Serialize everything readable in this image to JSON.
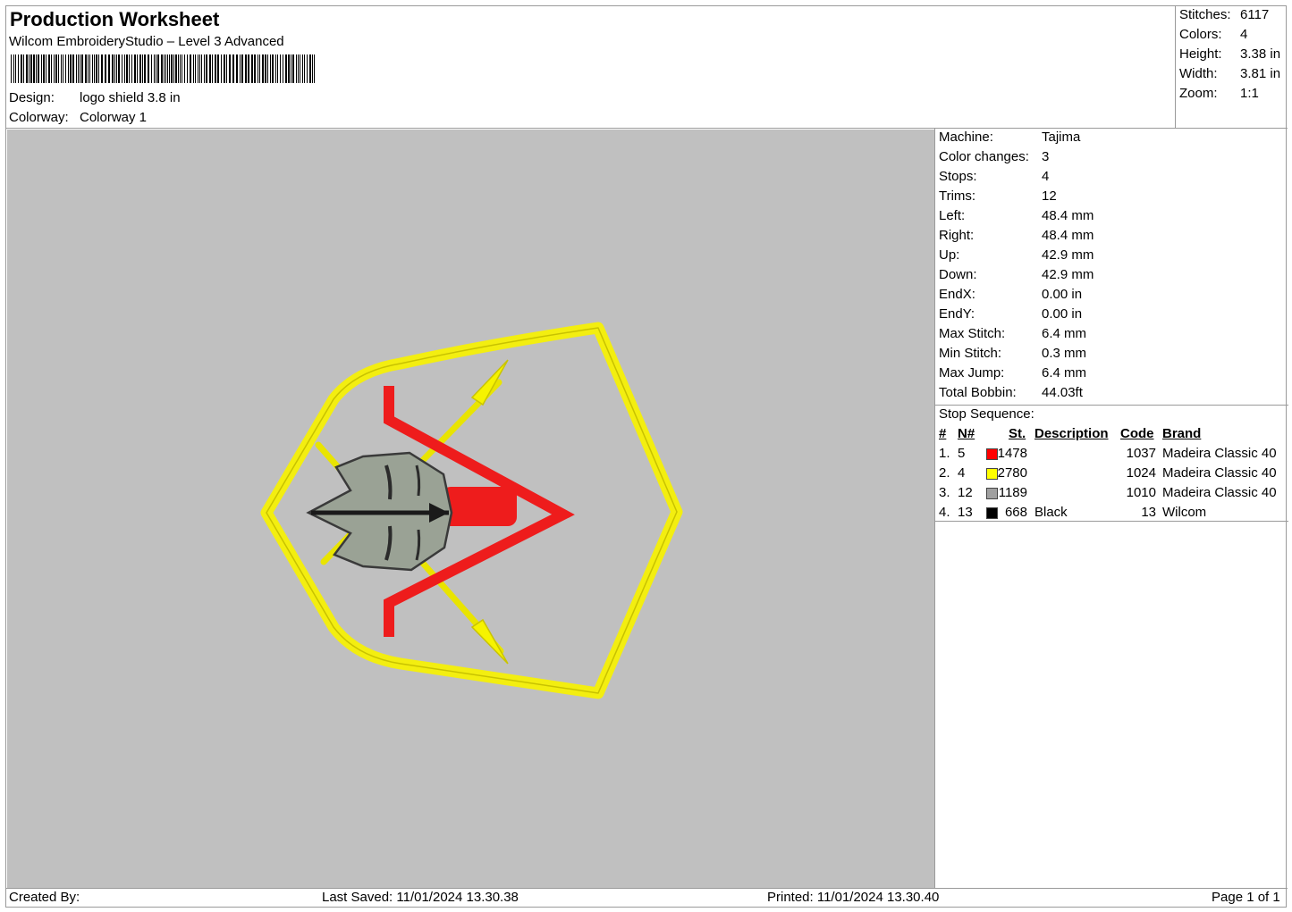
{
  "header": {
    "title": "Production Worksheet",
    "subtitle": "Wilcom EmbroideryStudio – Level 3 Advanced",
    "design_label": "Design:",
    "design_value": "logo shield 3.8 in",
    "colorway_label": "Colorway:",
    "colorway_value": "Colorway 1"
  },
  "stats": [
    {
      "label": "Stitches:",
      "value": "6117"
    },
    {
      "label": "Colors:",
      "value": "4"
    },
    {
      "label": "Height:",
      "value": "3.38 in"
    },
    {
      "label": "Width:",
      "value": "3.81 in"
    },
    {
      "label": "Zoom:",
      "value": "1:1"
    }
  ],
  "machine_info": [
    {
      "label": "Machine:",
      "value": "Tajima"
    },
    {
      "label": "Color changes:",
      "value": "3"
    },
    {
      "label": "Stops:",
      "value": "4"
    },
    {
      "label": "Trims:",
      "value": "12"
    },
    {
      "label": "Left:",
      "value": "48.4 mm"
    },
    {
      "label": "Right:",
      "value": "48.4 mm"
    },
    {
      "label": "Up:",
      "value": "42.9 mm"
    },
    {
      "label": "Down:",
      "value": "42.9 mm"
    },
    {
      "label": "EndX:",
      "value": "0.00 in"
    },
    {
      "label": "EndY:",
      "value": "0.00 in"
    },
    {
      "label": "Max Stitch:",
      "value": "6.4 mm"
    },
    {
      "label": "Min Stitch:",
      "value": "0.3 mm"
    },
    {
      "label": "Max Jump:",
      "value": "6.4 mm"
    },
    {
      "label": "Total Bobbin:",
      "value": "44.03ft"
    }
  ],
  "stop_sequence": {
    "title": "Stop Sequence:",
    "headers": {
      "num": "#",
      "n": "N#",
      "st": "St.",
      "description": "Description",
      "code": "Code",
      "brand": "Brand"
    },
    "rows": [
      {
        "num": "1.",
        "n": "5",
        "color": "#ff0000",
        "st": "1478",
        "description": "",
        "code": "1037",
        "brand": "Madeira Classic 40"
      },
      {
        "num": "2.",
        "n": "4",
        "color": "#ffff00",
        "st": "2780",
        "description": "",
        "code": "1024",
        "brand": "Madeira Classic 40"
      },
      {
        "num": "3.",
        "n": "12",
        "color": "#a0a0a0",
        "st": "1189",
        "description": "",
        "code": "1010",
        "brand": "Madeira Classic 40"
      },
      {
        "num": "4.",
        "n": "13",
        "color": "#000000",
        "st": "668",
        "description": "Black",
        "code": "13",
        "brand": "Wilcom"
      }
    ]
  },
  "footer": {
    "created_by": "Created By:",
    "last_saved": "Last Saved: 11/01/2024 13.30.38",
    "printed": "Printed: 11/01/2024 13.30.40",
    "page": "Page 1 of 1"
  },
  "colors": {
    "canvas_bg": "#c0c0c0",
    "yellow_thread": "#ffff00",
    "red_thread": "#ff0000",
    "gray_thread": "#a0a0a0",
    "black_thread": "#000000"
  },
  "design_preview": {
    "icon": "shield-logo-embroidery"
  }
}
